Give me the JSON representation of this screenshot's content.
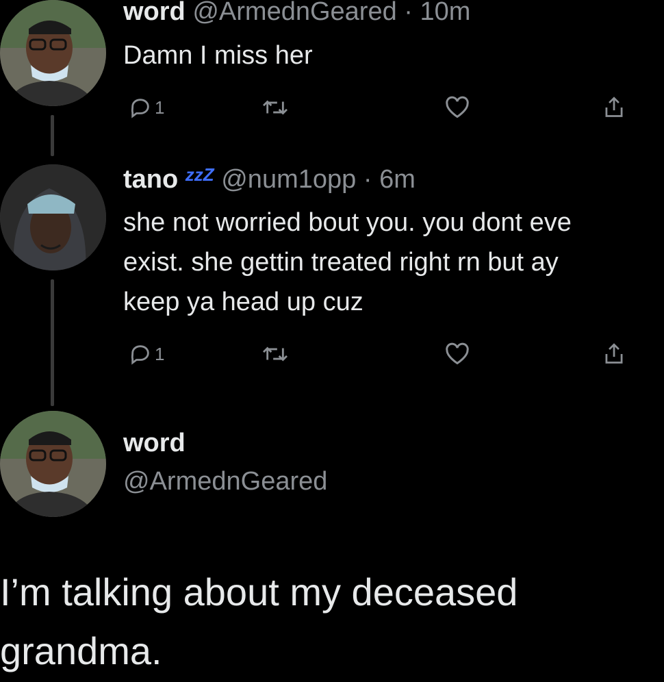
{
  "tweets": [
    {
      "name": "word",
      "handle": "@ArmednGeared",
      "dot": "·",
      "time": "10m",
      "text": "Damn I miss her",
      "reply_count": "1",
      "icons": [
        "reply-icon",
        "retweet-icon",
        "like-icon",
        "share-icon"
      ]
    },
    {
      "name": "tano",
      "status_emoji": "zzZ",
      "handle": "@num1opp",
      "dot": "·",
      "time": "6m",
      "text_lines": [
        "she not worried bout you. you dont eve",
        "exist. she gettin treated right rn but ay",
        "keep ya head up cuz"
      ],
      "reply_count": "1",
      "icons": [
        "reply-icon",
        "retweet-icon",
        "like-icon",
        "share-icon"
      ]
    }
  ],
  "reply_author": {
    "name": "word",
    "handle": "@ArmednGeared"
  },
  "main_reply": {
    "text": "I’m talking about my deceased grandma."
  },
  "colors": {
    "background": "#000000",
    "text": "#e7e9ea",
    "muted": "#8b8f94",
    "zzz": "#3f6fff"
  }
}
